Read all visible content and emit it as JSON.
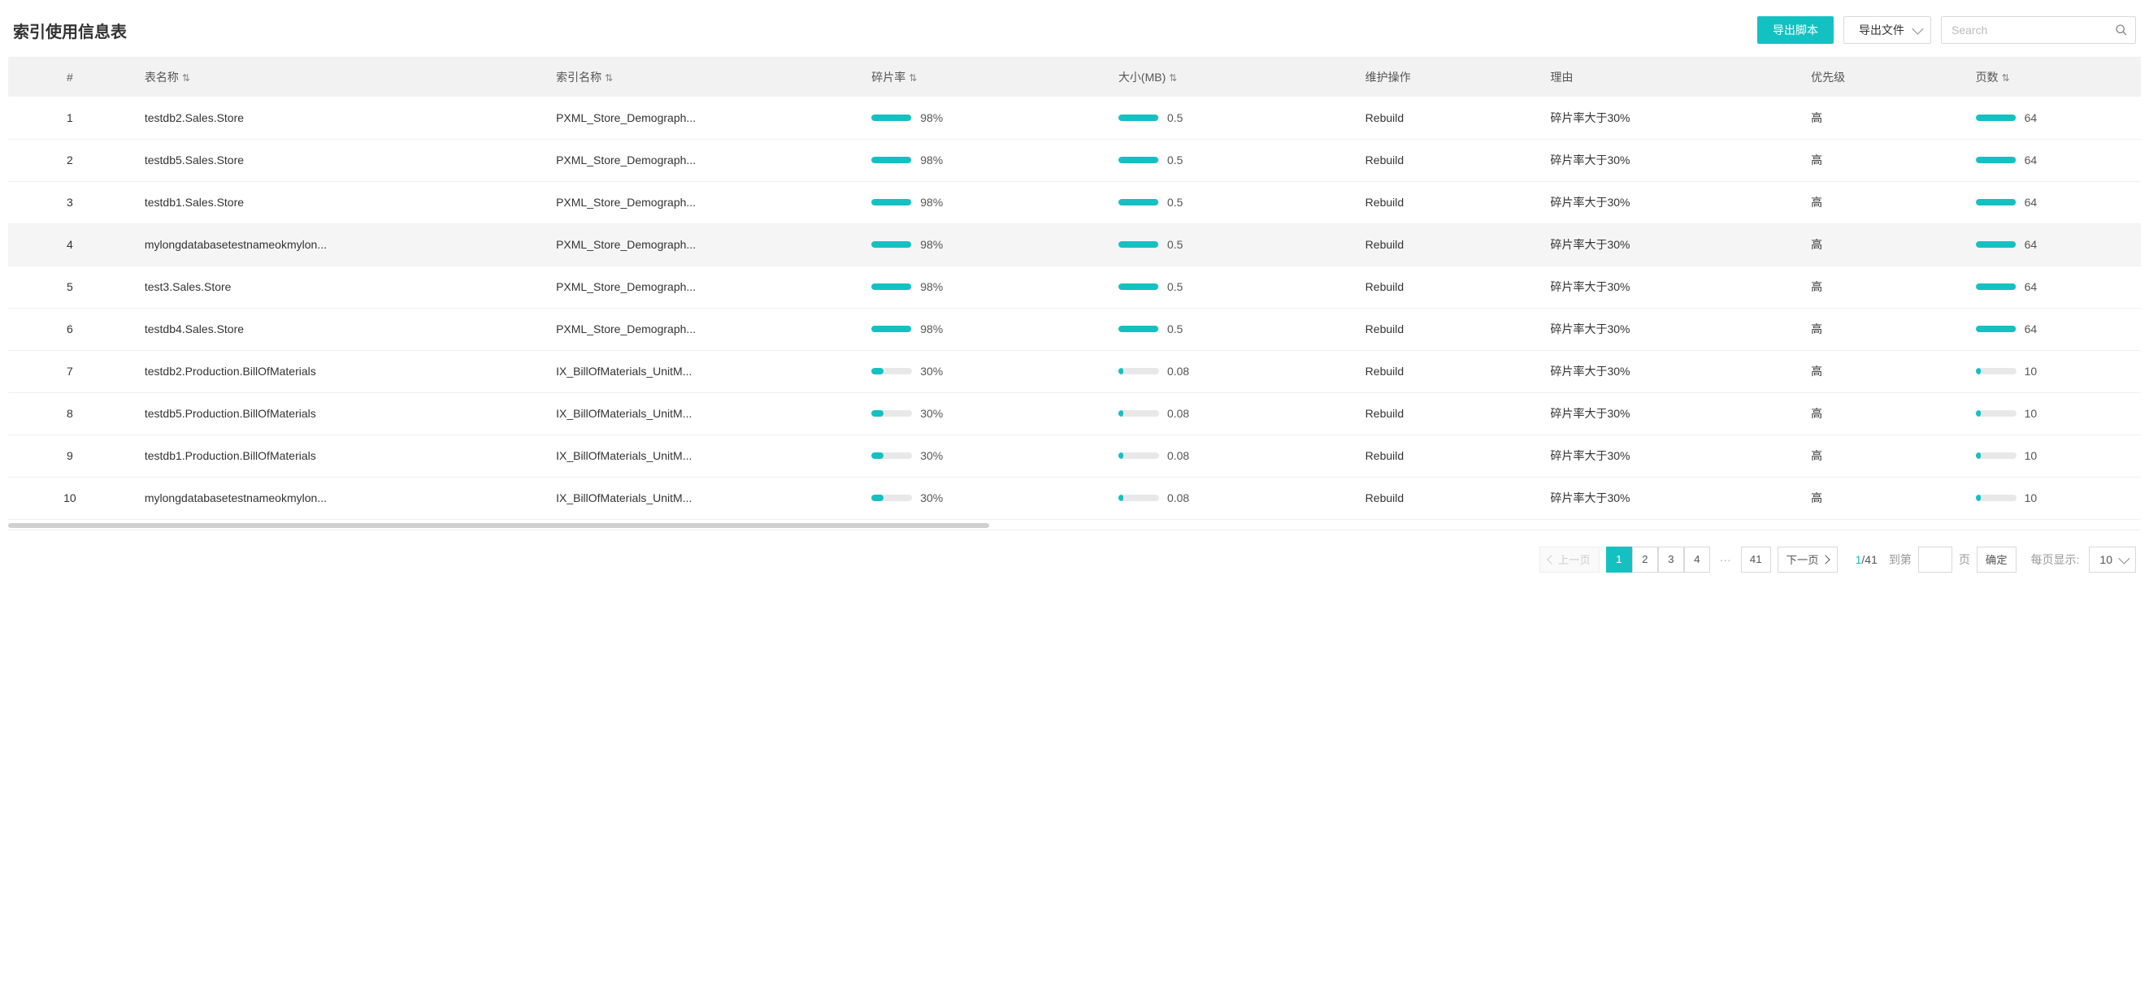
{
  "header": {
    "title": "索引使用信息表",
    "export_script_label": "导出脚本",
    "export_file_label": "导出文件",
    "search_placeholder": "Search"
  },
  "columns": {
    "idx": "#",
    "table_name": "表名称",
    "index_name": "索引名称",
    "frag_rate": "碎片率",
    "size_mb": "大小(MB)",
    "operation": "维护操作",
    "reason": "理由",
    "priority": "优先级",
    "pages": "页数"
  },
  "sort_glyph": "⇅",
  "rows": [
    {
      "idx": "1",
      "table_name": "testdb2.Sales.Store",
      "index_name": "PXML_Store_Demograph...",
      "frag_pct": 98,
      "frag_label": "98%",
      "size_pct": 98,
      "size_label": "0.5",
      "operation": "Rebuild",
      "reason": "碎片率大于30%",
      "priority": "高",
      "pages_pct": 98,
      "pages_label": "64",
      "hover": false
    },
    {
      "idx": "2",
      "table_name": "testdb5.Sales.Store",
      "index_name": "PXML_Store_Demograph...",
      "frag_pct": 98,
      "frag_label": "98%",
      "size_pct": 98,
      "size_label": "0.5",
      "operation": "Rebuild",
      "reason": "碎片率大于30%",
      "priority": "高",
      "pages_pct": 98,
      "pages_label": "64",
      "hover": false
    },
    {
      "idx": "3",
      "table_name": "testdb1.Sales.Store",
      "index_name": "PXML_Store_Demograph...",
      "frag_pct": 98,
      "frag_label": "98%",
      "size_pct": 98,
      "size_label": "0.5",
      "operation": "Rebuild",
      "reason": "碎片率大于30%",
      "priority": "高",
      "pages_pct": 98,
      "pages_label": "64",
      "hover": false
    },
    {
      "idx": "4",
      "table_name": "mylongdatabasetestnameokmylon...",
      "index_name": "PXML_Store_Demograph...",
      "frag_pct": 98,
      "frag_label": "98%",
      "size_pct": 98,
      "size_label": "0.5",
      "operation": "Rebuild",
      "reason": "碎片率大于30%",
      "priority": "高",
      "pages_pct": 98,
      "pages_label": "64",
      "hover": true
    },
    {
      "idx": "5",
      "table_name": "test3.Sales.Store",
      "index_name": "PXML_Store_Demograph...",
      "frag_pct": 98,
      "frag_label": "98%",
      "size_pct": 98,
      "size_label": "0.5",
      "operation": "Rebuild",
      "reason": "碎片率大于30%",
      "priority": "高",
      "pages_pct": 98,
      "pages_label": "64",
      "hover": false
    },
    {
      "idx": "6",
      "table_name": "testdb4.Sales.Store",
      "index_name": "PXML_Store_Demograph...",
      "frag_pct": 98,
      "frag_label": "98%",
      "size_pct": 98,
      "size_label": "0.5",
      "operation": "Rebuild",
      "reason": "碎片率大于30%",
      "priority": "高",
      "pages_pct": 98,
      "pages_label": "64",
      "hover": false
    },
    {
      "idx": "7",
      "table_name": "testdb2.Production.BillOfMaterials",
      "index_name": "IX_BillOfMaterials_UnitM...",
      "frag_pct": 30,
      "frag_label": "30%",
      "size_pct": 12,
      "size_label": "0.08",
      "operation": "Rebuild",
      "reason": "碎片率大于30%",
      "priority": "高",
      "pages_pct": 12,
      "pages_label": "10",
      "hover": false
    },
    {
      "idx": "8",
      "table_name": "testdb5.Production.BillOfMaterials",
      "index_name": "IX_BillOfMaterials_UnitM...",
      "frag_pct": 30,
      "frag_label": "30%",
      "size_pct": 12,
      "size_label": "0.08",
      "operation": "Rebuild",
      "reason": "碎片率大于30%",
      "priority": "高",
      "pages_pct": 12,
      "pages_label": "10",
      "hover": false
    },
    {
      "idx": "9",
      "table_name": "testdb1.Production.BillOfMaterials",
      "index_name": "IX_BillOfMaterials_UnitM...",
      "frag_pct": 30,
      "frag_label": "30%",
      "size_pct": 12,
      "size_label": "0.08",
      "operation": "Rebuild",
      "reason": "碎片率大于30%",
      "priority": "高",
      "pages_pct": 12,
      "pages_label": "10",
      "hover": false
    },
    {
      "idx": "10",
      "table_name": "mylongdatabasetestnameokmylon...",
      "index_name": "IX_BillOfMaterials_UnitM...",
      "frag_pct": 30,
      "frag_label": "30%",
      "size_pct": 12,
      "size_label": "0.08",
      "operation": "Rebuild",
      "reason": "碎片率大于30%",
      "priority": "高",
      "pages_pct": 12,
      "pages_label": "10",
      "hover": false
    }
  ],
  "pagination": {
    "prev_label": "上一页",
    "next_label": "下一页",
    "pages": [
      "1",
      "2",
      "3",
      "4"
    ],
    "active_page": "1",
    "last_page": "41",
    "ellipsis": "···",
    "current_display": "1",
    "total_display": "/41",
    "goto_label": "到第",
    "page_unit": "页",
    "confirm_label": "确定",
    "pagesize_label": "每页显示:",
    "pagesize_value": "10"
  }
}
